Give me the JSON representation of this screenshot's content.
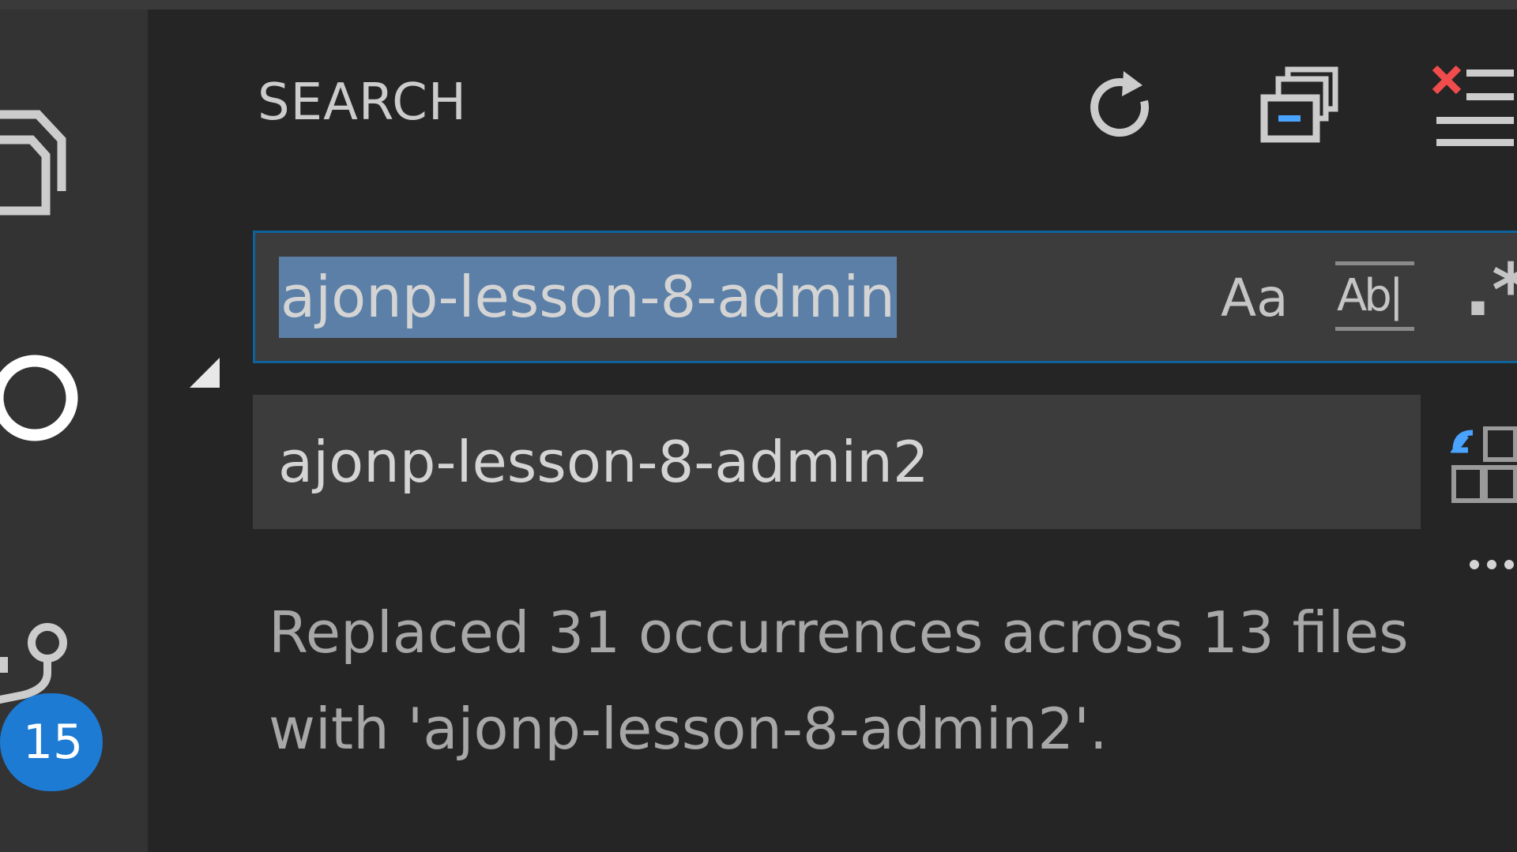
{
  "sidebar": {
    "title": "SEARCH",
    "actions": [
      "refresh-icon",
      "collapse-all-icon",
      "clear-results-icon"
    ]
  },
  "search": {
    "value": "ajonp-lesson-8-admin",
    "options": {
      "match_case": "Aa",
      "whole_word": "Ab|",
      "regex": ".*"
    }
  },
  "replace": {
    "value": "ajonp-lesson-8-admin2"
  },
  "results": {
    "message": "Replaced 31 occurrences across 13 files with 'ajonp-lesson-8-admin2'."
  },
  "activity_bar": {
    "scm_badge": "15"
  },
  "colors": {
    "accent": "#0e639c",
    "selection": "#5b7fa6",
    "badge": "#1d7bd4",
    "error_red": "#f14c4c"
  }
}
